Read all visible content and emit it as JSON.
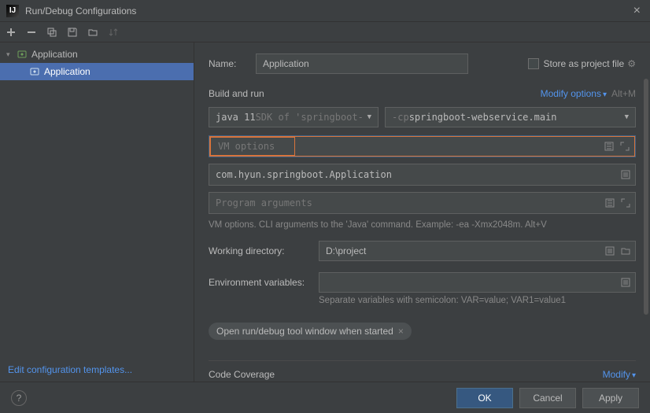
{
  "titlebar": {
    "title": "Run/Debug Configurations"
  },
  "sidebar": {
    "group_label": "Application",
    "items": [
      "Application"
    ],
    "edit_templates": "Edit configuration templates..."
  },
  "form": {
    "name_label": "Name:",
    "name_value": "Application",
    "store_project_file": "Store as project file"
  },
  "build": {
    "section_title": "Build and run",
    "modify_options": "Modify options",
    "modify_shortcut": "Alt+M",
    "jdk_prefix": "java 11",
    "jdk_detail": " SDK of 'springboot-",
    "classpath_prefix": "-cp ",
    "classpath_value": "springboot-webservice.main",
    "vm_options_placeholder": "VM options",
    "main_class": "com.hyun.springboot.Application",
    "program_args_placeholder": "Program arguments",
    "vm_hint": "VM options. CLI arguments to the 'Java' command. Example: -ea -Xmx2048m. Alt+V",
    "workdir_label": "Working directory:",
    "workdir_value": "D:\\project",
    "env_label": "Environment variables:",
    "env_hint": "Separate variables with semicolon: VAR=value; VAR1=value1",
    "open_tool_window": "Open run/debug tool window when started"
  },
  "coverage": {
    "title": "Code Coverage",
    "modify": "Modify"
  },
  "footer": {
    "ok": "OK",
    "cancel": "Cancel",
    "apply": "Apply"
  }
}
